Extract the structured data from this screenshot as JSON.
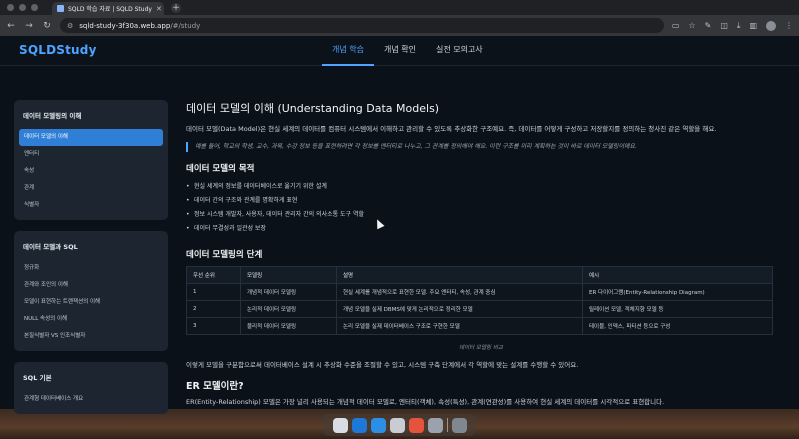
{
  "browser": {
    "tab_title": "SQLD 학습 자료 | SQLD Study",
    "url_host": "sqld-study-3f30a.web.app",
    "url_path": "/#/study"
  },
  "app": {
    "logo": "SQLDStudy",
    "nav": [
      {
        "label": "개념 학습",
        "active": true
      },
      {
        "label": "개념 확인",
        "active": false
      },
      {
        "label": "실전 모의고사",
        "active": false
      }
    ]
  },
  "sidebar": {
    "sections": [
      {
        "title": "데이터 모델링의 이해",
        "items": [
          "데이터 모델의 이해",
          "엔터티",
          "속성",
          "관계",
          "식별자"
        ]
      },
      {
        "title": "데이터 모델과 SQL",
        "items": [
          "정규화",
          "관계와 조인의 이해",
          "모델이 표현하는 트랜잭션의 이해",
          "NULL 속성의 이해",
          "본질식별자 VS 인조식별자"
        ]
      },
      {
        "title": "SQL 기본",
        "items": [
          "관계형 데이터베이스 개요"
        ]
      }
    ],
    "active_item": "데이터 모델의 이해"
  },
  "content": {
    "title": "데이터 모델의 이해 (Understanding Data Models)",
    "intro": "데이터 모델(Data Model)은 현실 세계의 데이터를 컴퓨터 시스템에서 이해하고 관리할 수 있도록 추상화한 구조예요. 즉, 데이터를 어떻게 구성하고 저장할지를 정의하는 청사진 같은 역할을 해요.",
    "quote": "예를 들어, 학교의 학생, 교수, 과목, 수강 정보 등을 표현하려면 각 정보를 엔터티로 나누고, 그 관계를 정의해야 해요. 이런 구조를 미리 계획하는 것이 바로 데이터 모델링이에요.",
    "purpose_heading": "데이터 모델의 목적",
    "purpose_items": [
      "현실 세계의 정보를 데이터베이스로 옮기기 위한 설계",
      "데이터 간의 구조와 관계를 명확하게 표현",
      "정보 시스템 개발자, 사용자, 데이터 관리자 간의 의사소통 도구 역할",
      "데이터 무결성과 일관성 보장"
    ],
    "steps_heading": "데이터 모델링의 단계",
    "table": {
      "headers": [
        "우선 순위",
        "모델링",
        "설명",
        "예시"
      ],
      "rows": [
        [
          "1",
          "개념적 데이터 모델링",
          "현실 세계를 개념적으로 표현한 모델. 주요 엔터티, 속성, 관계 중심",
          "ER 다이어그램(Entity-Relationship Diagram)"
        ],
        [
          "2",
          "논리적 데이터 모델링",
          "개념 모델을 실제 DBMS에 맞게 논리적으로 정리한 모델",
          "릴레이션 모델, 객체지향 모델 등"
        ],
        [
          "3",
          "물리적 데이터 모델링",
          "논리 모델을 실제 데이터베이스 구조로 구현한 모델",
          "테이블, 인덱스, 파티션 등으로 구성"
        ]
      ],
      "caption": "데이터 모델링 비교"
    },
    "steps_summary": "이렇게 모델을 구분함으로써 데이터베이스 설계 시 추상화 수준을 조절할 수 있고, 시스템 구축 단계에서 각 역할에 맞는 설계를 수행할 수 있어요.",
    "er_heading": "ER 모델이란?",
    "er_text": "ER(Entity-Relationship) 모델은 가장 널리 사용되는 개념적 데이터 모델로, 엔터티(객체), 속성(특성), 관계(연관성)를 사용하여 현실 세계의 데이터를 시각적으로 표현합니다."
  }
}
